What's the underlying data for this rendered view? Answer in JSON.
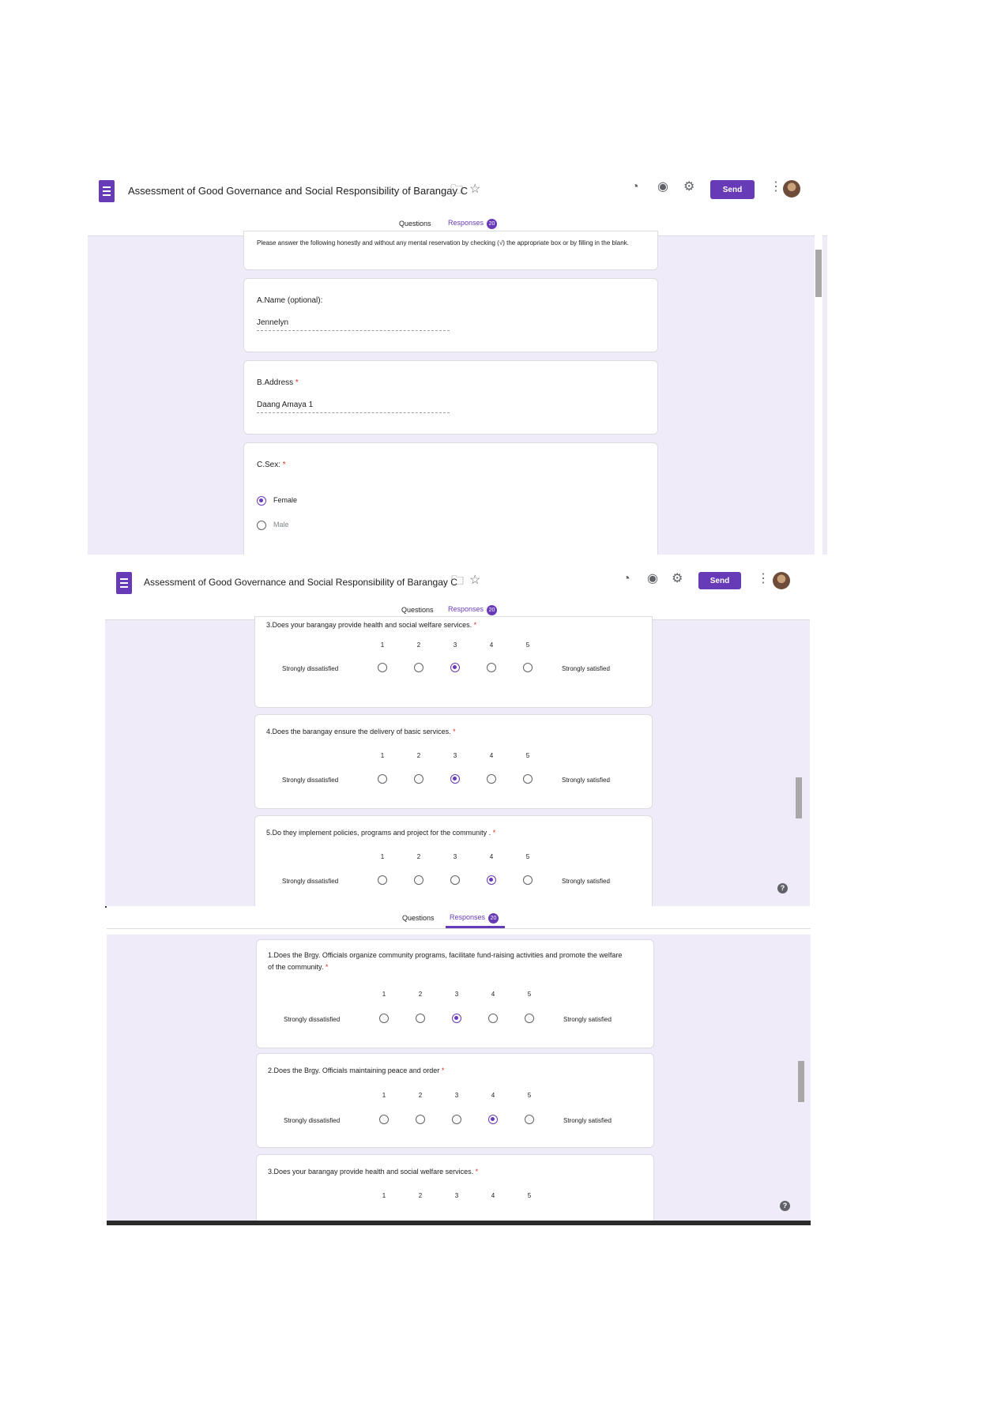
{
  "app": {
    "form_title": "Assessment of Good Governance and Social Responsibility of Barangay C",
    "send_label": "Send",
    "tab_questions": "Questions",
    "tab_responses": "Responses",
    "responses_count": "20",
    "icons": [
      "forms-icon",
      "folder-icon",
      "star-icon",
      "palette-icon",
      "eye-icon",
      "gear-icon",
      "more-vert-icon",
      "avatar",
      "help-icon"
    ],
    "accent_color": "#673ab7"
  },
  "screen1": {
    "instructions": "Please answer the following honestly and without any mental reservation by checking (√) the appropriate box or by filling in the blank.",
    "name_label": "A.Name (optional):",
    "name_value": "Jennelyn",
    "address_label": "B.Address",
    "address_value": "Daang Amaya 1",
    "sex_label": "C.Sex:",
    "required_mark": "*",
    "sex_options": [
      "Female",
      "Male"
    ],
    "sex_selected": "Female"
  },
  "scale": {
    "numbers": [
      "1",
      "2",
      "3",
      "4",
      "5"
    ],
    "low_label": "Strongly dissatisfied",
    "high_label": "Strongly satisfied"
  },
  "screen2": {
    "q3": "3.Does your barangay provide health and social welfare services.",
    "q3_selected": 3,
    "q4": "4.Does the barangay ensure the delivery of basic services.",
    "q4_selected": 3,
    "q5": "5.Do they implement policies, programs and project for the community .",
    "q5_selected": 4
  },
  "screen3": {
    "q1": "1.Does the Brgy. Officials organize community programs, facilitate fund-raising activities and promote the welfare of the community.",
    "q1_selected": 3,
    "q2": "2.Does the Brgy. Officials maintaining peace and order",
    "q2_selected": 4,
    "q3": "3.Does your barangay provide health and social welfare services."
  }
}
